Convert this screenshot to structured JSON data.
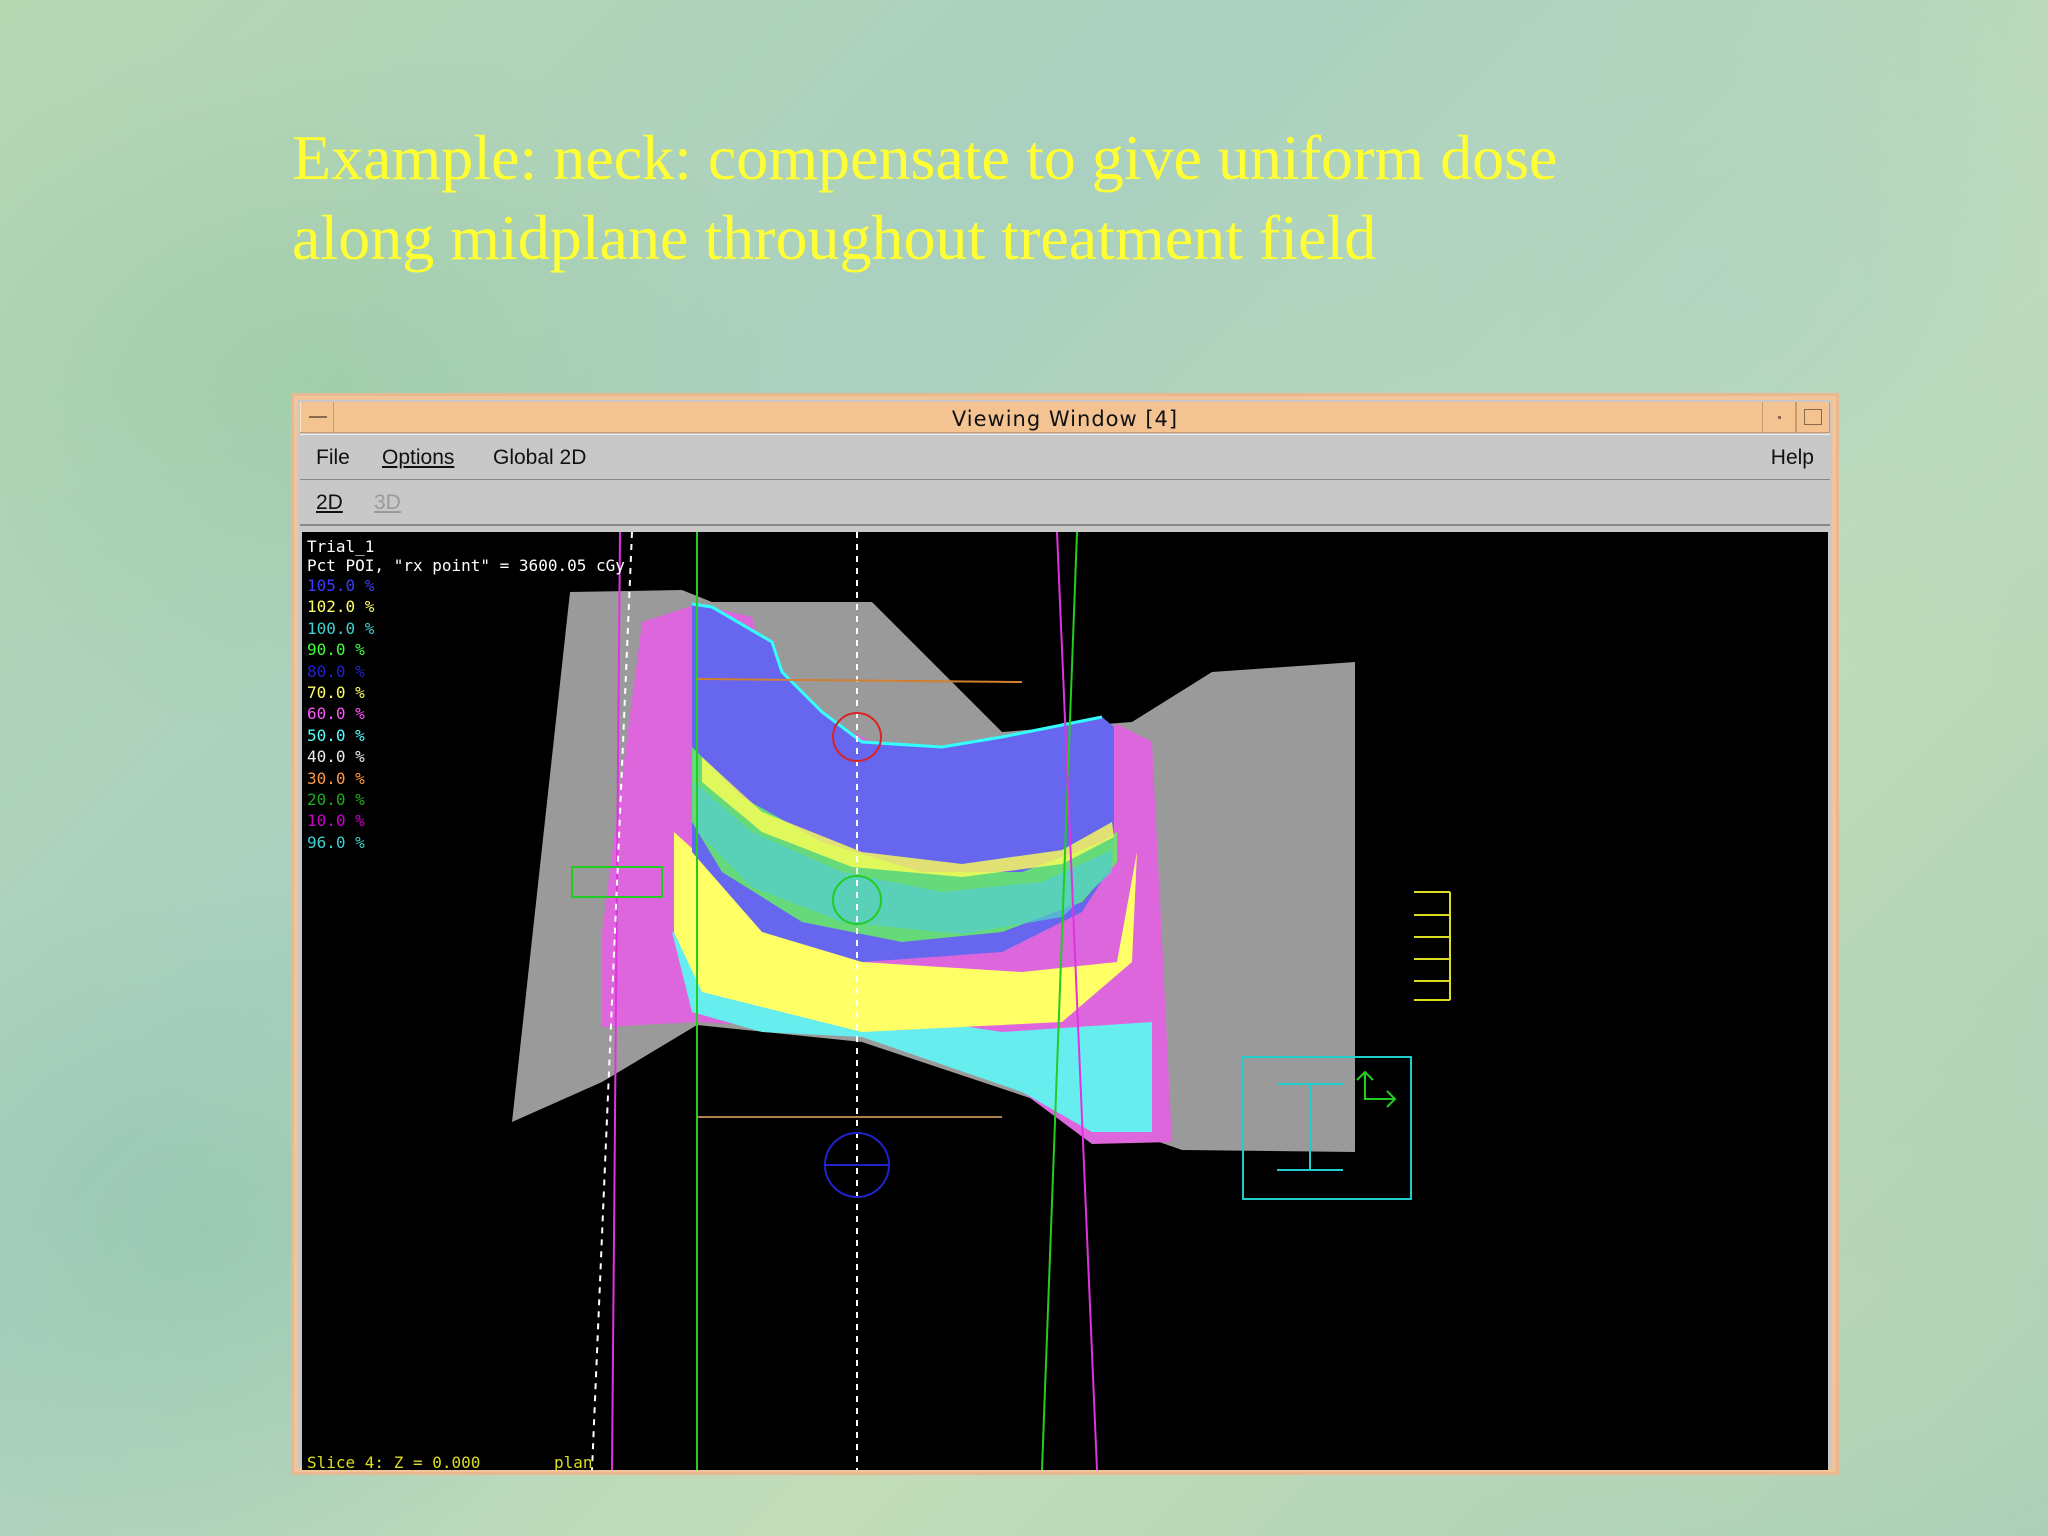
{
  "slide": {
    "title_line1": "Example: neck: compensate to give uniform dose",
    "title_line2": "along midplane throughout treatment field"
  },
  "window": {
    "title": "Viewing Window [4]",
    "menus": [
      "File",
      "Options",
      "Global 2D"
    ],
    "help": "Help",
    "modes": [
      "2D",
      "3D"
    ]
  },
  "viewport": {
    "trial": "Trial_1",
    "normalization": "Pct POI, \"rx point\" = 3600.05 cGy",
    "isodose_legend": [
      {
        "label": "105.0 %",
        "color": "#3b3bff"
      },
      {
        "label": "102.0 %",
        "color": "#ffff66"
      },
      {
        "label": "100.0 %",
        "color": "#40d0d0"
      },
      {
        "label": "90.0 %",
        "color": "#40ff40"
      },
      {
        "label": "80.0 %",
        "color": "#2222cc"
      },
      {
        "label": "70.0 %",
        "color": "#ffff66"
      },
      {
        "label": "60.0 %",
        "color": "#ff55ff"
      },
      {
        "label": "50.0 %",
        "color": "#55ffff"
      },
      {
        "label": "40.0 %",
        "color": "#eeeeee"
      },
      {
        "label": "30.0 %",
        "color": "#ff9944"
      },
      {
        "label": "20.0 %",
        "color": "#22aa22"
      },
      {
        "label": "10.0 %",
        "color": "#cc00cc"
      },
      {
        "label": "96.0 %",
        "color": "#40d0d0"
      }
    ],
    "slice_info": "Slice 4: Z = 0.000",
    "plan_label": "plan"
  }
}
